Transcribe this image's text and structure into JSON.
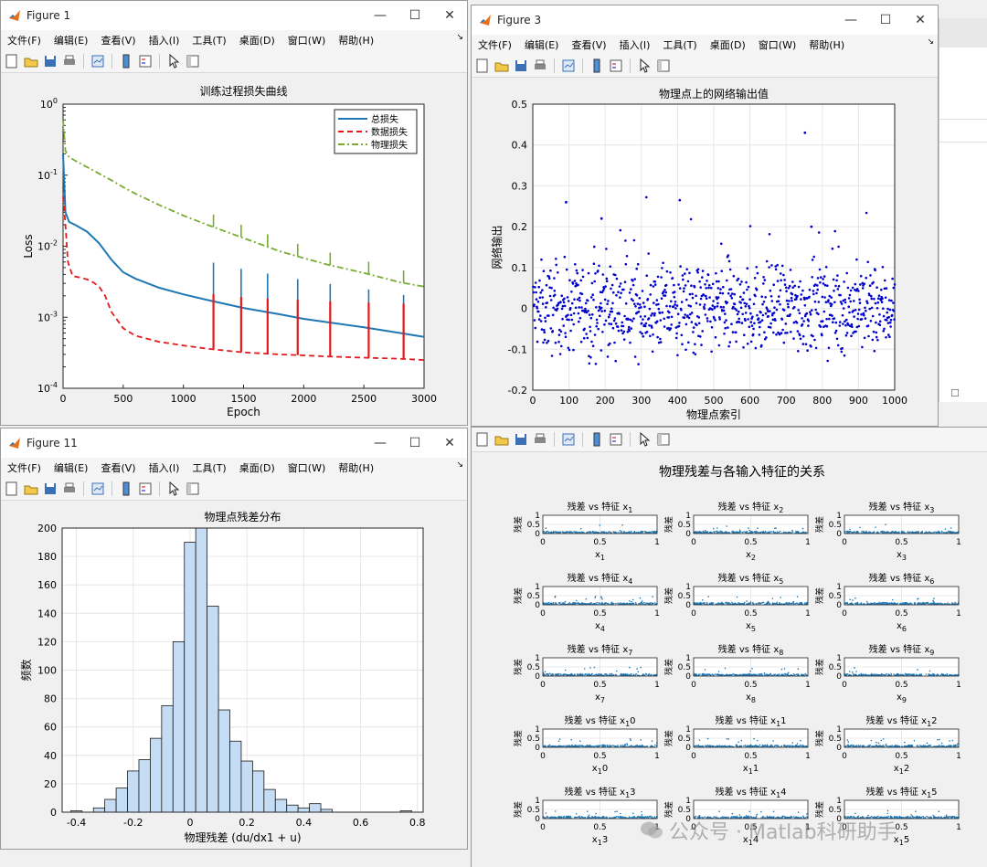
{
  "fig1": {
    "title": "Figure 1",
    "chart_data": {
      "type": "line",
      "title": "训练过程损失曲线",
      "xlabel": "Epoch",
      "ylabel": "Loss",
      "xlim": [
        0,
        3000
      ],
      "ylim": [
        0.0001,
        1
      ],
      "yscale": "log",
      "xticks": [
        0,
        500,
        1000,
        1500,
        2000,
        2500,
        3000
      ],
      "yticks": [
        "10^-4",
        "10^-3",
        "10^-2",
        "10^-1",
        "10^0"
      ],
      "legend_position": "top-right",
      "series": [
        {
          "name": "总损失",
          "color": "#1f77b4",
          "style": "solid",
          "x": [
            0,
            20,
            50,
            100,
            200,
            300,
            400,
            500,
            600,
            800,
            1000,
            1200,
            1500,
            1800,
            2000,
            2200,
            2500,
            2800,
            3000
          ],
          "y": [
            0.2,
            0.03,
            0.022,
            0.02,
            0.016,
            0.011,
            0.0065,
            0.0043,
            0.0035,
            0.0026,
            0.0021,
            0.00175,
            0.00135,
            0.0011,
            0.00095,
            0.00085,
            0.00072,
            0.0006,
            0.00053
          ]
        },
        {
          "name": "数据损失",
          "color": "#e31a1c",
          "style": "dashed",
          "x": [
            0,
            20,
            40,
            80,
            150,
            200,
            250,
            300,
            350,
            400,
            500,
            600,
            800,
            1000,
            1200,
            1500,
            1800,
            2000,
            2200,
            2500,
            2800,
            3000
          ],
          "y": [
            0.05,
            0.02,
            0.006,
            0.0038,
            0.0036,
            0.0034,
            0.0031,
            0.0027,
            0.002,
            0.0012,
            0.0007,
            0.00055,
            0.00045,
            0.0004,
            0.00036,
            0.00032,
            0.0003,
            0.00029,
            0.00028,
            0.00027,
            0.00026,
            0.00025
          ]
        },
        {
          "name": "物理损失",
          "color": "#77ac30",
          "style": "dashdot",
          "x": [
            0,
            20,
            50,
            100,
            200,
            300,
            400,
            500,
            600,
            800,
            1000,
            1200,
            1500,
            1800,
            2000,
            2200,
            2500,
            2800,
            3000
          ],
          "y": [
            0.6,
            0.22,
            0.18,
            0.16,
            0.13,
            0.105,
            0.085,
            0.068,
            0.055,
            0.038,
            0.027,
            0.02,
            0.013,
            0.0085,
            0.0068,
            0.0055,
            0.0042,
            0.0031,
            0.0027
          ]
        }
      ],
      "spikes_x": [
        1250,
        1480,
        1700,
        1950,
        2220,
        2540,
        2830
      ]
    }
  },
  "fig3": {
    "title": "Figure 3",
    "chart_data": {
      "type": "scatter",
      "title": "物理点上的网络输出值",
      "xlabel": "物理点索引",
      "ylabel": "网络输出",
      "xlim": [
        0,
        1000
      ],
      "ylim": [
        -0.2,
        0.5
      ],
      "xticks": [
        0,
        100,
        200,
        300,
        400,
        500,
        600,
        700,
        800,
        900,
        1000
      ],
      "yticks": [
        -0.2,
        -0.1,
        0,
        0.1,
        0.2,
        0.3,
        0.4,
        0.5
      ],
      "grid": true,
      "color": "#0000cc",
      "count": 1000,
      "notable_points": [
        [
          92,
          0.26
        ],
        [
          190,
          0.22
        ],
        [
          752,
          0.43
        ],
        [
          770,
          0.2
        ]
      ]
    }
  },
  "fig11": {
    "title": "Figure 11",
    "chart_data": {
      "type": "bar",
      "title": "物理点残差分布",
      "xlabel": "物理残差 (du/dx1 + u)",
      "ylabel": "频数",
      "xlim": [
        -0.45,
        0.82
      ],
      "ylim": [
        0,
        200
      ],
      "xticks": [
        -0.4,
        -0.2,
        0,
        0.2,
        0.4,
        0.6,
        0.8
      ],
      "yticks": [
        0,
        20,
        40,
        60,
        80,
        100,
        120,
        140,
        160,
        180,
        200
      ],
      "grid": true,
      "bin_width": 0.04,
      "bins_left": [
        -0.42,
        -0.38,
        -0.34,
        -0.3,
        -0.26,
        -0.22,
        -0.18,
        -0.14,
        -0.1,
        -0.06,
        -0.02,
        0.02,
        0.06,
        0.1,
        0.14,
        0.18,
        0.22,
        0.26,
        0.3,
        0.34,
        0.38,
        0.42,
        0.46,
        0.5,
        0.54,
        0.58,
        0.62,
        0.66,
        0.7,
        0.74
      ],
      "values": [
        1,
        0,
        3,
        9,
        17,
        29,
        37,
        52,
        75,
        120,
        190,
        220,
        145,
        72,
        50,
        36,
        29,
        16,
        9,
        5,
        3,
        6,
        2,
        0,
        0,
        0,
        0,
        0,
        0,
        1
      ],
      "color": "#c5dcf5"
    }
  },
  "fig_right": {
    "suptitle": "物理残差与各输入特征的关系",
    "panels": [
      {
        "title": "残差 vs 特征 x",
        "sub": "1",
        "xlabel": "x",
        "xsub": "1"
      },
      {
        "title": "残差 vs 特征 x",
        "sub": "2",
        "xlabel": "x",
        "xsub": "2"
      },
      {
        "title": "残差 vs 特征 x",
        "sub": "3",
        "xlabel": "x",
        "xsub": "3"
      },
      {
        "title": "残差 vs 特征 x",
        "sub": "4",
        "xlabel": "x",
        "xsub": "4"
      },
      {
        "title": "残差 vs 特征 x",
        "sub": "5",
        "xlabel": "x",
        "xsub": "5"
      },
      {
        "title": "残差 vs 特征 x",
        "sub": "6",
        "xlabel": "x",
        "xsub": "6"
      },
      {
        "title": "残差 vs 特征 x",
        "sub": "7",
        "xlabel": "x",
        "xsub": "7"
      },
      {
        "title": "残差 vs 特征 x",
        "sub": "8",
        "xlabel": "x",
        "xsub": "8"
      },
      {
        "title": "残差 vs 特征 x",
        "sub": "9",
        "xlabel": "x",
        "xsub": "9"
      },
      {
        "title": "残差 vs 特征 x",
        "sub": "1",
        "after": "0",
        "xlabel": "x",
        "xsub": "1",
        "xafter": "0"
      },
      {
        "title": "残差 vs 特征 x",
        "sub": "1",
        "after": "1",
        "xlabel": "x",
        "xsub": "1",
        "xafter": "1"
      },
      {
        "title": "残差 vs 特征 x",
        "sub": "1",
        "after": "2",
        "xlabel": "x",
        "xsub": "1",
        "xafter": "2"
      },
      {
        "title": "残差 vs 特征 x",
        "sub": "1",
        "after": "3",
        "xlabel": "x",
        "xsub": "1",
        "xafter": "3"
      },
      {
        "title": "残差 vs 特征 x",
        "sub": "1",
        "after": "4",
        "xlabel": "x",
        "xsub": "1",
        "xafter": "4"
      },
      {
        "title": "残差 vs 特征 x",
        "sub": "1",
        "after": "5",
        "xlabel": "x",
        "xsub": "1",
        "xafter": "5"
      }
    ],
    "panel_ylabel": "残差",
    "panel_yticks": [
      "1",
      "0.5",
      "0"
    ],
    "panel_xticks": [
      "0",
      "0.5",
      "1"
    ],
    "color": "#1f77b4"
  },
  "menu": {
    "items": [
      "文件(F)",
      "编辑(E)",
      "查看(V)",
      "插入(I)",
      "工具(T)",
      "桌面(D)",
      "窗口(W)",
      "帮助(H)"
    ]
  },
  "watermark": "公众号 · Matlab科研助手",
  "colors": {
    "accent": "#0072bd",
    "window_bg": "#f0f0f0"
  }
}
